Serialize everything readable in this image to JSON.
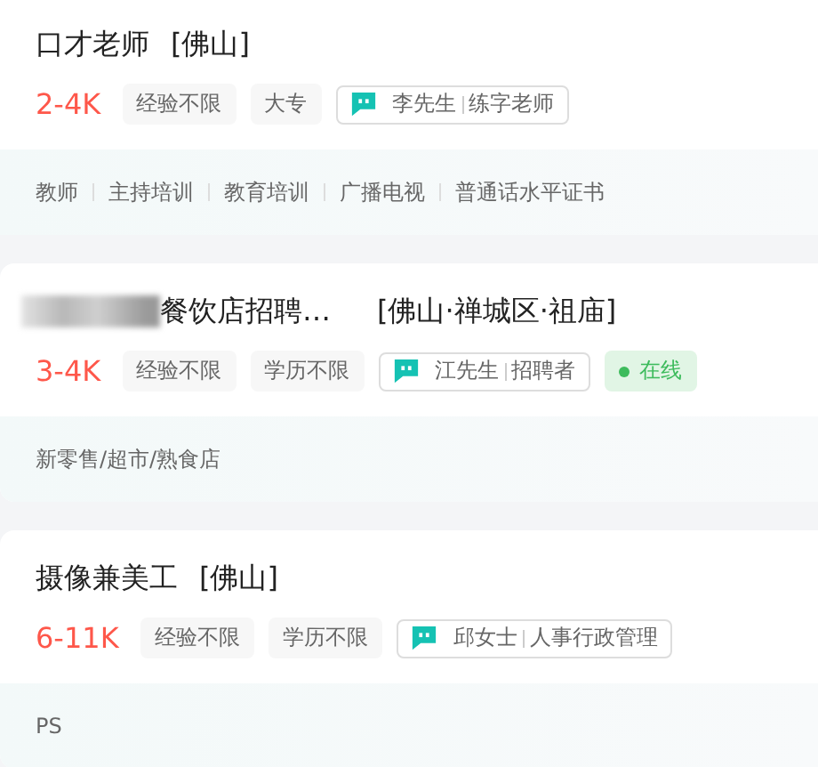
{
  "jobs": [
    {
      "title": "口才老师",
      "location": "[佛山]",
      "redacted_prefix": false,
      "salary": "2-4K",
      "requirements": [
        "经验不限",
        "大专"
      ],
      "recruiter": {
        "name": "李先生",
        "role": "练字老师"
      },
      "keywords": [
        "教师",
        "主持培训",
        "教育培训",
        "广播电视",
        "普通话水平证书"
      ]
    },
    {
      "title": "餐饮店招聘…",
      "location": "[佛山·禅城区·祖庙]",
      "redacted_prefix": true,
      "salary": "3-4K",
      "requirements": [
        "经验不限",
        "学历不限"
      ],
      "recruiter": {
        "name": "江先生",
        "role": "招聘者"
      },
      "status_badge": "在线",
      "keywords": [
        "新零售/超市/熟食店"
      ]
    },
    {
      "title": "摄像兼美工",
      "location": "[佛山]",
      "redacted_prefix": false,
      "salary": "6-11K",
      "requirements": [
        "经验不限",
        "学历不限"
      ],
      "recruiter": {
        "name": "邱女士",
        "role": "人事行政管理"
      },
      "keywords": [
        "PS"
      ]
    }
  ]
}
